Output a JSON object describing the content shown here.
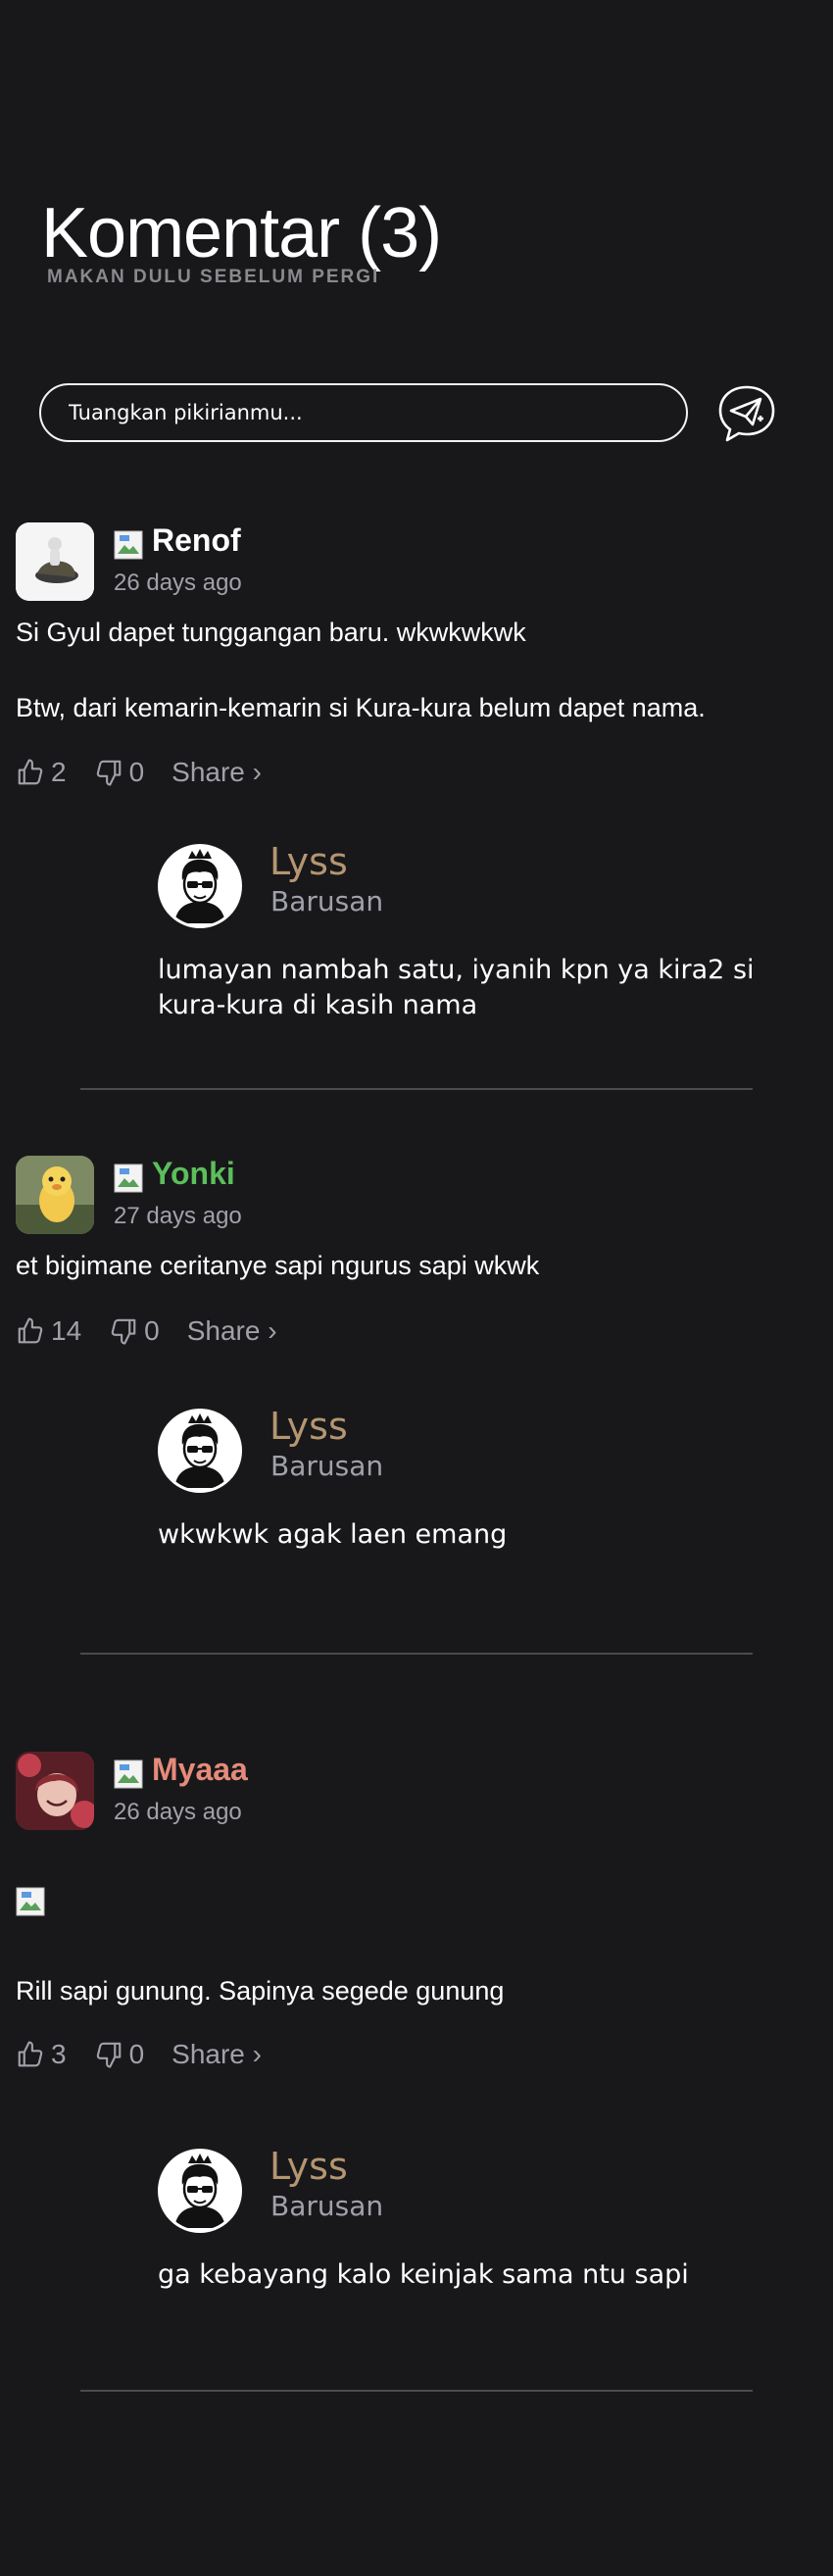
{
  "header": {
    "title": "Komentar (3)",
    "subtitle": "MAKAN DULU SEBELUM PERGI"
  },
  "composer": {
    "placeholder": "Tuangkan pikirianmu...",
    "send_icon": "send-plane-icon"
  },
  "colors": {
    "background": "#18181b",
    "renof": "#ffffff",
    "yonki": "#5bbf5b",
    "myaaa": "#e58b7a",
    "reply_name": "#b59670",
    "muted": "#a1a1aa"
  },
  "comments": [
    {
      "username": "Renof",
      "time": "26 days ago",
      "lines": [
        "Si Gyul dapet tunggangan baru. wkwkwkwk",
        "Btw, dari kemarin-kemarin si Kura-kura belum dapet nama."
      ],
      "likes": "2",
      "dislikes": "0",
      "share": "Share ›",
      "reply": {
        "name": "Lyss",
        "time": "Barusan",
        "text": "lumayan nambah satu, iyanih kpn ya kira2 si kura-kura di kasih nama"
      }
    },
    {
      "username": "Yonki",
      "time": "27 days ago",
      "lines": [
        "et bigimane ceritanye sapi ngurus sapi wkwk"
      ],
      "likes": "14",
      "dislikes": "0",
      "share": "Share ›",
      "reply": {
        "name": "Lyss",
        "time": "Barusan",
        "text": "wkwkwk agak laen emang"
      }
    },
    {
      "username": "Myaaa",
      "time": "26 days ago",
      "lines": [
        "Rill sapi gunung. Sapinya segede gunung"
      ],
      "likes": "3",
      "dislikes": "0",
      "share": "Share ›",
      "reply": {
        "name": "Lyss",
        "time": "Barusan",
        "text": "ga kebayang kalo keinjak sama ntu sapi"
      }
    }
  ]
}
